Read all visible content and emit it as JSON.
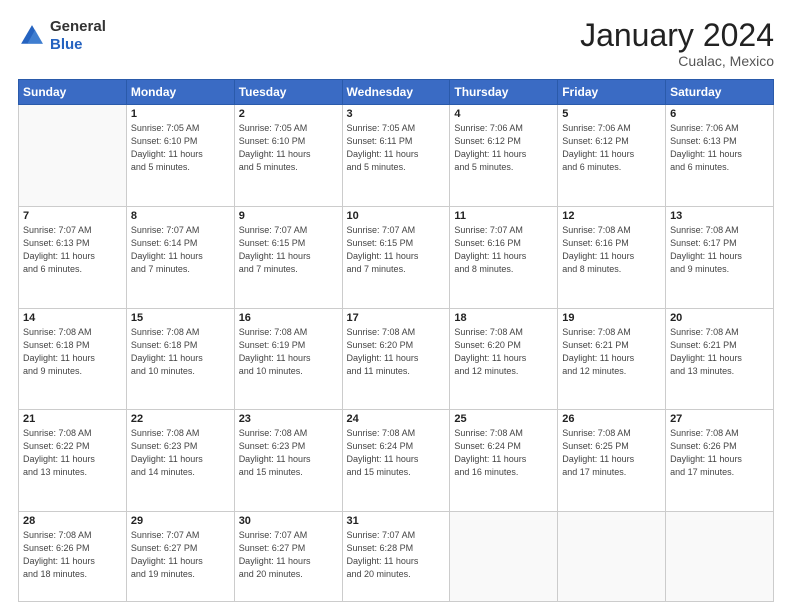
{
  "header": {
    "logo_line1": "General",
    "logo_line2": "Blue",
    "month": "January 2024",
    "location": "Cualac, Mexico"
  },
  "weekdays": [
    "Sunday",
    "Monday",
    "Tuesday",
    "Wednesday",
    "Thursday",
    "Friday",
    "Saturday"
  ],
  "weeks": [
    [
      {
        "day": "",
        "info": ""
      },
      {
        "day": "1",
        "info": "Sunrise: 7:05 AM\nSunset: 6:10 PM\nDaylight: 11 hours\nand 5 minutes."
      },
      {
        "day": "2",
        "info": "Sunrise: 7:05 AM\nSunset: 6:10 PM\nDaylight: 11 hours\nand 5 minutes."
      },
      {
        "day": "3",
        "info": "Sunrise: 7:05 AM\nSunset: 6:11 PM\nDaylight: 11 hours\nand 5 minutes."
      },
      {
        "day": "4",
        "info": "Sunrise: 7:06 AM\nSunset: 6:12 PM\nDaylight: 11 hours\nand 5 minutes."
      },
      {
        "day": "5",
        "info": "Sunrise: 7:06 AM\nSunset: 6:12 PM\nDaylight: 11 hours\nand 6 minutes."
      },
      {
        "day": "6",
        "info": "Sunrise: 7:06 AM\nSunset: 6:13 PM\nDaylight: 11 hours\nand 6 minutes."
      }
    ],
    [
      {
        "day": "7",
        "info": "Sunrise: 7:07 AM\nSunset: 6:13 PM\nDaylight: 11 hours\nand 6 minutes."
      },
      {
        "day": "8",
        "info": "Sunrise: 7:07 AM\nSunset: 6:14 PM\nDaylight: 11 hours\nand 7 minutes."
      },
      {
        "day": "9",
        "info": "Sunrise: 7:07 AM\nSunset: 6:15 PM\nDaylight: 11 hours\nand 7 minutes."
      },
      {
        "day": "10",
        "info": "Sunrise: 7:07 AM\nSunset: 6:15 PM\nDaylight: 11 hours\nand 7 minutes."
      },
      {
        "day": "11",
        "info": "Sunrise: 7:07 AM\nSunset: 6:16 PM\nDaylight: 11 hours\nand 8 minutes."
      },
      {
        "day": "12",
        "info": "Sunrise: 7:08 AM\nSunset: 6:16 PM\nDaylight: 11 hours\nand 8 minutes."
      },
      {
        "day": "13",
        "info": "Sunrise: 7:08 AM\nSunset: 6:17 PM\nDaylight: 11 hours\nand 9 minutes."
      }
    ],
    [
      {
        "day": "14",
        "info": "Sunrise: 7:08 AM\nSunset: 6:18 PM\nDaylight: 11 hours\nand 9 minutes."
      },
      {
        "day": "15",
        "info": "Sunrise: 7:08 AM\nSunset: 6:18 PM\nDaylight: 11 hours\nand 10 minutes."
      },
      {
        "day": "16",
        "info": "Sunrise: 7:08 AM\nSunset: 6:19 PM\nDaylight: 11 hours\nand 10 minutes."
      },
      {
        "day": "17",
        "info": "Sunrise: 7:08 AM\nSunset: 6:20 PM\nDaylight: 11 hours\nand 11 minutes."
      },
      {
        "day": "18",
        "info": "Sunrise: 7:08 AM\nSunset: 6:20 PM\nDaylight: 11 hours\nand 12 minutes."
      },
      {
        "day": "19",
        "info": "Sunrise: 7:08 AM\nSunset: 6:21 PM\nDaylight: 11 hours\nand 12 minutes."
      },
      {
        "day": "20",
        "info": "Sunrise: 7:08 AM\nSunset: 6:21 PM\nDaylight: 11 hours\nand 13 minutes."
      }
    ],
    [
      {
        "day": "21",
        "info": "Sunrise: 7:08 AM\nSunset: 6:22 PM\nDaylight: 11 hours\nand 13 minutes."
      },
      {
        "day": "22",
        "info": "Sunrise: 7:08 AM\nSunset: 6:23 PM\nDaylight: 11 hours\nand 14 minutes."
      },
      {
        "day": "23",
        "info": "Sunrise: 7:08 AM\nSunset: 6:23 PM\nDaylight: 11 hours\nand 15 minutes."
      },
      {
        "day": "24",
        "info": "Sunrise: 7:08 AM\nSunset: 6:24 PM\nDaylight: 11 hours\nand 15 minutes."
      },
      {
        "day": "25",
        "info": "Sunrise: 7:08 AM\nSunset: 6:24 PM\nDaylight: 11 hours\nand 16 minutes."
      },
      {
        "day": "26",
        "info": "Sunrise: 7:08 AM\nSunset: 6:25 PM\nDaylight: 11 hours\nand 17 minutes."
      },
      {
        "day": "27",
        "info": "Sunrise: 7:08 AM\nSunset: 6:26 PM\nDaylight: 11 hours\nand 17 minutes."
      }
    ],
    [
      {
        "day": "28",
        "info": "Sunrise: 7:08 AM\nSunset: 6:26 PM\nDaylight: 11 hours\nand 18 minutes."
      },
      {
        "day": "29",
        "info": "Sunrise: 7:07 AM\nSunset: 6:27 PM\nDaylight: 11 hours\nand 19 minutes."
      },
      {
        "day": "30",
        "info": "Sunrise: 7:07 AM\nSunset: 6:27 PM\nDaylight: 11 hours\nand 20 minutes."
      },
      {
        "day": "31",
        "info": "Sunrise: 7:07 AM\nSunset: 6:28 PM\nDaylight: 11 hours\nand 20 minutes."
      },
      {
        "day": "",
        "info": ""
      },
      {
        "day": "",
        "info": ""
      },
      {
        "day": "",
        "info": ""
      }
    ]
  ]
}
